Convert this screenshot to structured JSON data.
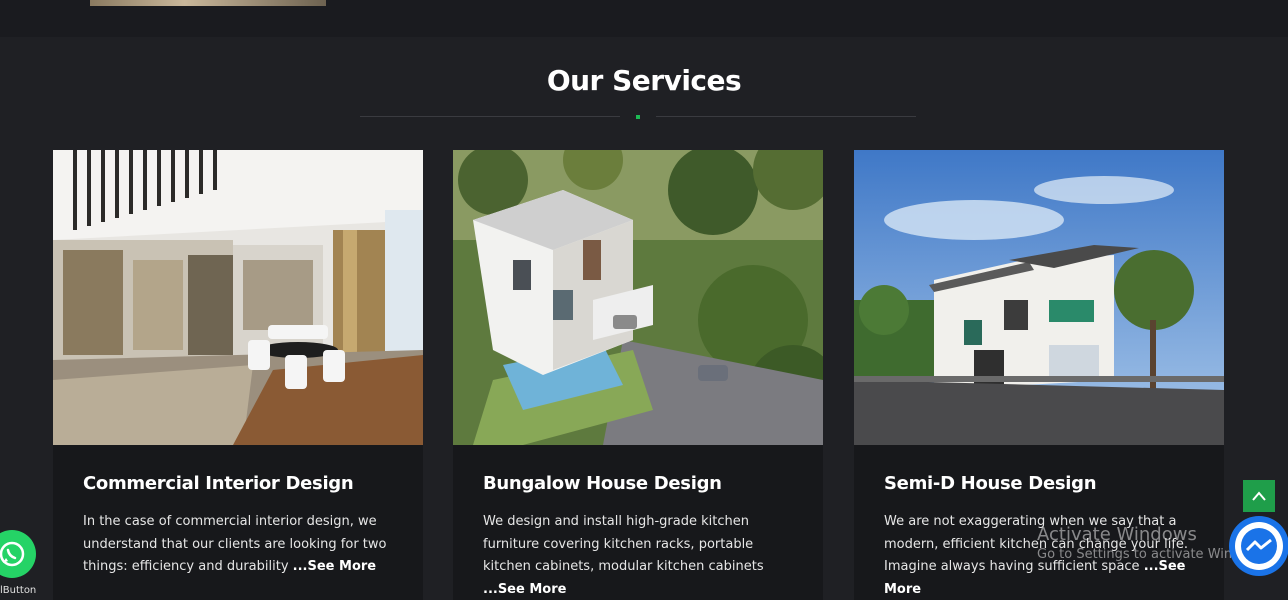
{
  "section": {
    "title": "Our Services",
    "accent_color": "#1db954"
  },
  "cards": [
    {
      "title": "Commercial Interior Design",
      "text": "In the case of commercial interior design, we understand that our clients are looking for two things: efficiency and durability ",
      "more": "...See More",
      "image": "office-interior-photo"
    },
    {
      "title": "Bungalow House Design",
      "text": "We design and install high-grade kitchen furniture covering kitchen racks, portable kitchen cabinets, modular kitchen cabinets ",
      "more": "...See More",
      "image": "bungalow-aerial-photo"
    },
    {
      "title": "Semi-D House Design",
      "text": "We are not exaggerating when we say that a modern, efficient kitchen can change your life. Imagine always having sufficient space ",
      "more": "...See More",
      "image": "semi-d-house-photo"
    }
  ],
  "overlay": {
    "activate_title": "Activate Windows",
    "activate_sub": "Go to Settings to activate Windows."
  },
  "widgets": {
    "whatsapp_label": "lButton",
    "scroll_top_icon": "chevron-up-icon",
    "messenger_icon": "messenger-icon",
    "whatsapp_icon": "whatsapp-icon",
    "scroll_top_color": "#1f9e4a",
    "messenger_color": "#1a73e8",
    "whatsapp_color": "#25d366"
  }
}
